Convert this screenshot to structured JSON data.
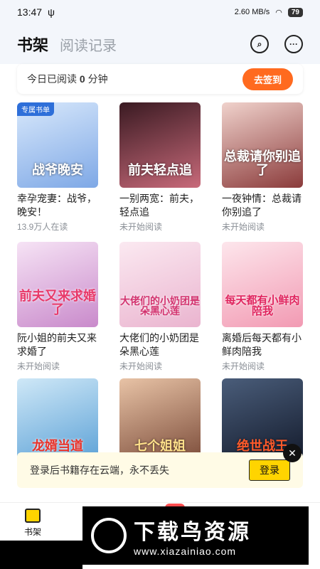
{
  "status": {
    "time": "13:47",
    "net_speed": "2.60\nMB/s",
    "battery": "79"
  },
  "header": {
    "tab_active": "书架",
    "tab_other": "阅读记录"
  },
  "reading": {
    "prefix": "今日已阅读 ",
    "minutes": "0",
    "suffix": " 分钟",
    "checkin": "去签到"
  },
  "books": [
    {
      "cover_text": "战爷晚安",
      "badge": "专属书单",
      "title": "幸孕宠妻：战爷，晚安！",
      "meta": "13.9万人在读",
      "color": "#a7c7f2"
    },
    {
      "cover_text": "前夫轻点追",
      "badge": "",
      "title": "一别两宽：前夫，轻点追",
      "meta": "未开始阅读",
      "color": "#7a2a3a"
    },
    {
      "cover_text": "总裁请你别追了",
      "badge": "",
      "title": "一夜钟情：总裁请你别追了",
      "meta": "未开始阅读",
      "color": "#d9a8a8"
    },
    {
      "cover_text": "前夫又来求婚了",
      "badge": "",
      "title": "阮小姐的前夫又来求婚了",
      "meta": "未开始阅读",
      "color": "#e9c5e8"
    },
    {
      "cover_text": "大佬们的小奶团是朵黑心莲",
      "badge": "",
      "title": "大佬们的小奶团是朵黑心莲",
      "meta": "未开始阅读",
      "color": "#f5dbe8"
    },
    {
      "cover_text": "每天都有小鲜肉陪我",
      "badge": "",
      "title": "离婚后每天都有小鲜肉陪我",
      "meta": "未开始阅读",
      "color": "#f7d4de"
    },
    {
      "cover_text": "龙婿当道",
      "badge": "",
      "title": "",
      "meta": "",
      "color": "#8cc4ea"
    },
    {
      "cover_text": "七个姐姐",
      "badge": "",
      "title": "",
      "meta": "",
      "color": "#c98b6a"
    },
    {
      "cover_text": "绝世战王",
      "badge": "",
      "title": "",
      "meta": "",
      "color": "#27364f"
    }
  ],
  "login_banner": {
    "text": "登录后书籍存在云端，永不丢失",
    "button": "登录",
    "close": "✕"
  },
  "nav": {
    "bookshelf": "书架"
  },
  "watermark": {
    "cn": "下载鸟资源",
    "url": "www.xiazainiao.com"
  }
}
